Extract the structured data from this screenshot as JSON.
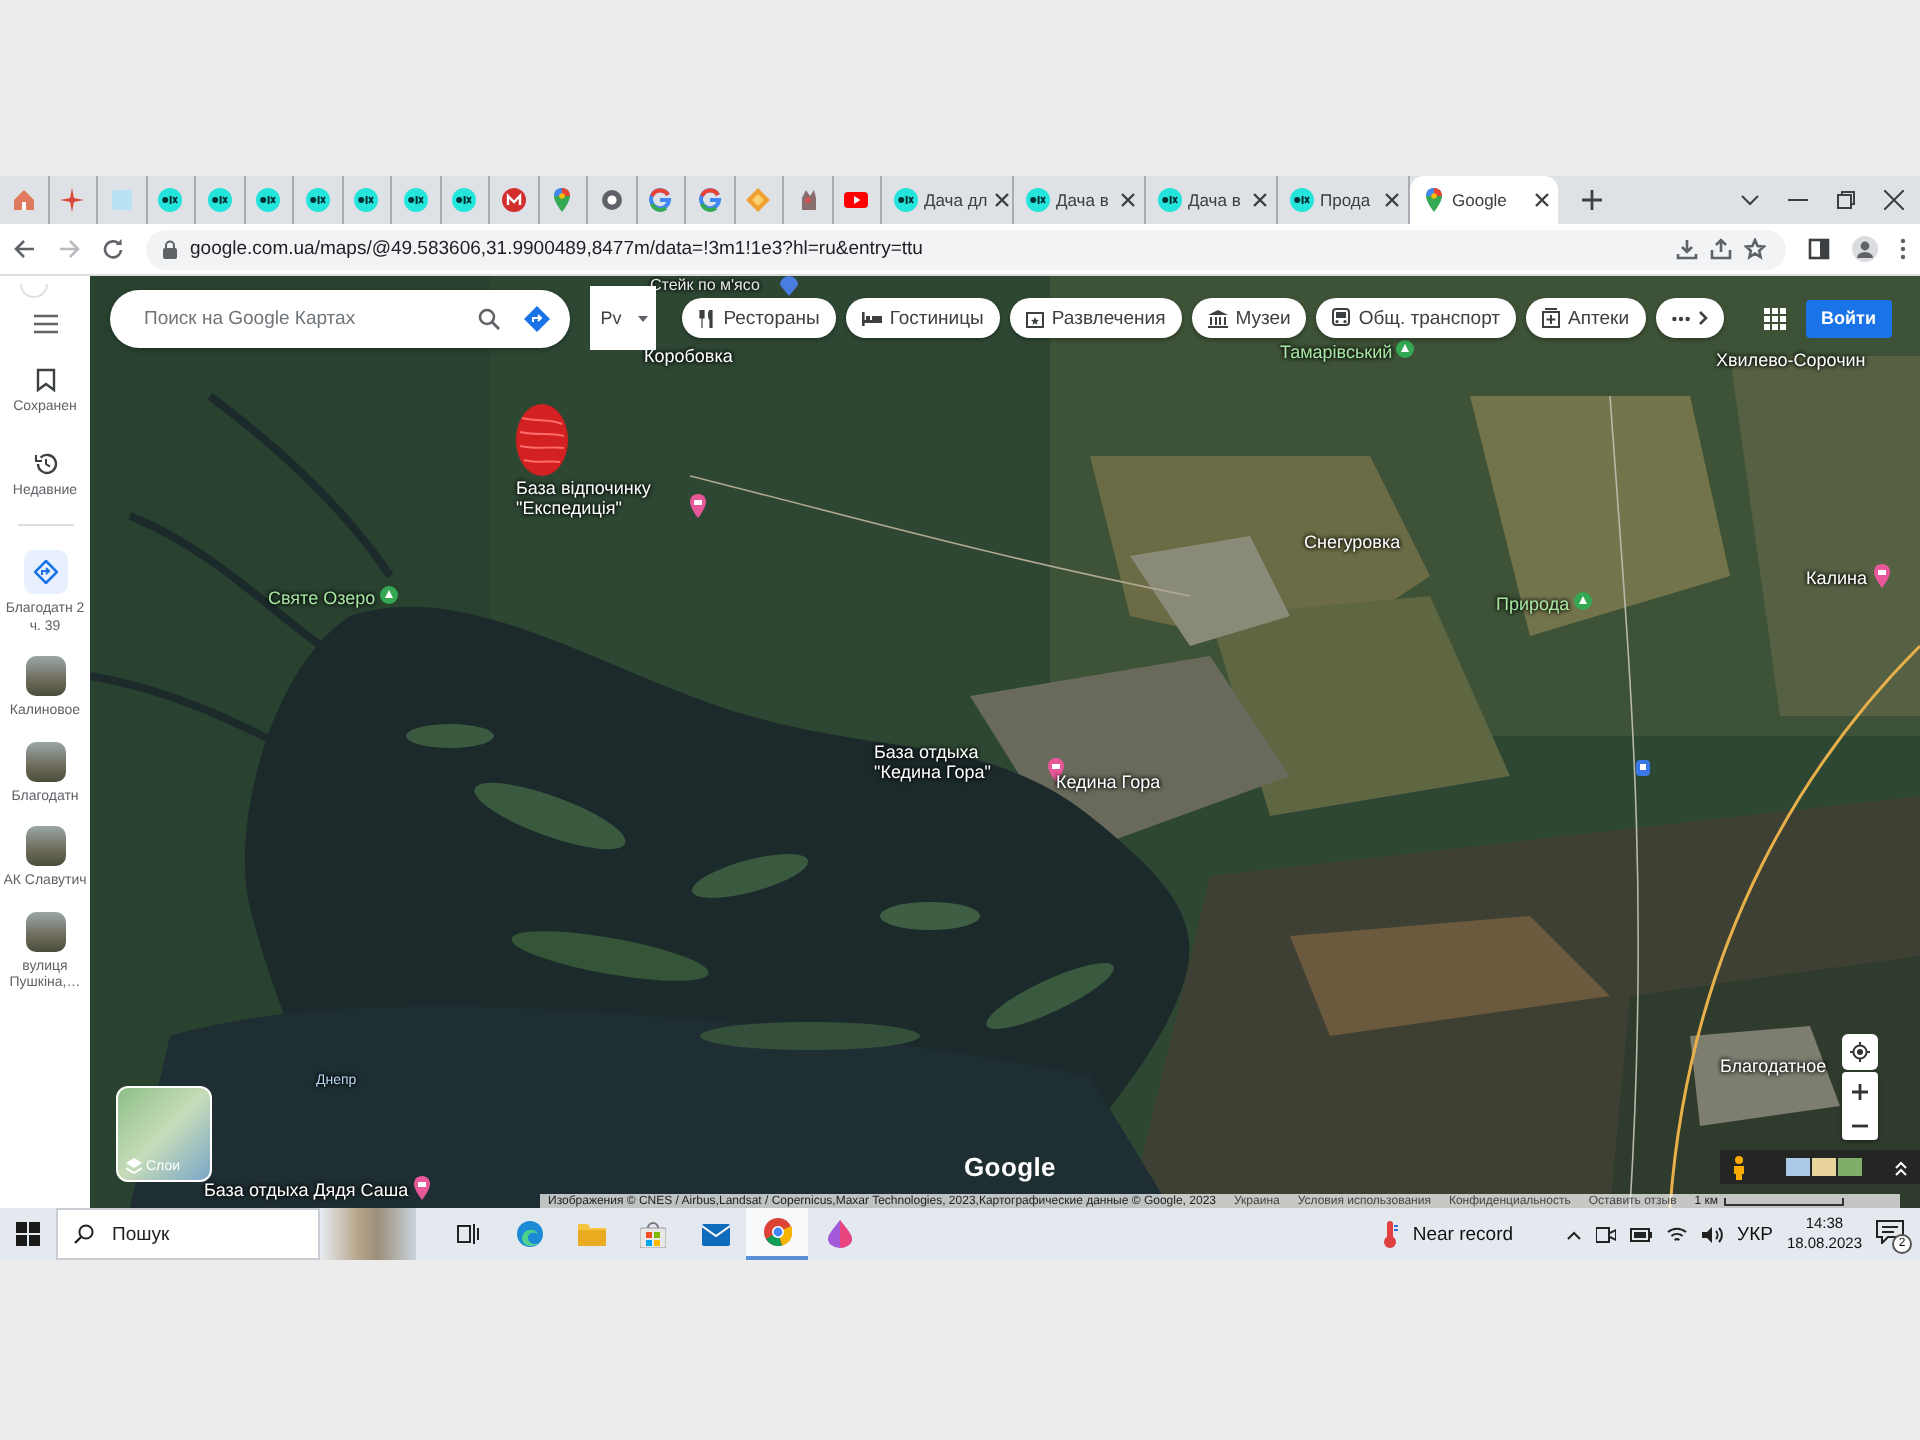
{
  "browser": {
    "tabs": [
      {
        "kind": "home",
        "selected": false
      },
      {
        "kind": "sparkle",
        "selected": false
      },
      {
        "kind": "square",
        "selected": false
      },
      {
        "kind": "olx",
        "selected": false
      },
      {
        "kind": "olx",
        "selected": false
      },
      {
        "kind": "olx",
        "selected": false
      },
      {
        "kind": "olx",
        "selected": false
      },
      {
        "kind": "olx",
        "selected": false
      },
      {
        "kind": "olx",
        "selected": false
      },
      {
        "kind": "olx",
        "selected": false
      },
      {
        "kind": "mail",
        "selected": false
      },
      {
        "kind": "pin",
        "selected": false
      },
      {
        "kind": "ring",
        "selected": false
      },
      {
        "kind": "google",
        "selected": false
      },
      {
        "kind": "google",
        "selected": false
      },
      {
        "kind": "fox",
        "selected": false
      },
      {
        "kind": "cat",
        "selected": false
      },
      {
        "kind": "youtube",
        "selected": false
      },
      {
        "kind": "olx",
        "label": "Дача дл",
        "selected": false
      },
      {
        "kind": "olx",
        "label": "Дача в",
        "selected": false
      },
      {
        "kind": "olx",
        "label": "Дача в",
        "selected": false
      },
      {
        "kind": "olx",
        "label": "Прода",
        "selected": false
      },
      {
        "kind": "pin",
        "label": "Google",
        "selected": true
      }
    ],
    "address": "google.com.ua/maps/@49.583606,31.9900489,8477m/data=!3m1!1e3?hl=ru&entry=ttu"
  },
  "sidebar": {
    "items": [
      {
        "kind": "saved",
        "label": "Сохранен"
      },
      {
        "kind": "recent",
        "label": "Недавние"
      }
    ],
    "places": [
      {
        "kind": "route",
        "label": "Благодатн 2 ч. 39"
      },
      {
        "kind": "photo",
        "label": "Калиновое"
      },
      {
        "kind": "photo",
        "label": "Благодатн"
      },
      {
        "kind": "photo",
        "label": "АК Славутич"
      },
      {
        "kind": "photo",
        "label": "вулиця Пушкіна,…"
      }
    ]
  },
  "map": {
    "search": {
      "placeholder": "Поиск на Google Картах"
    },
    "mode_field": "Pv",
    "chips": [
      {
        "kind": "restaurant",
        "label": "Рестораны"
      },
      {
        "kind": "hotel",
        "label": "Гостиницы"
      },
      {
        "kind": "ticket",
        "label": "Развлечения"
      },
      {
        "kind": "museum",
        "label": "Музеи"
      },
      {
        "kind": "transit",
        "label": "Общ. транспорт"
      },
      {
        "kind": "pharmacy",
        "label": "Аптеки"
      }
    ],
    "sign_in": "Войти",
    "labels": [
      {
        "kind": "small",
        "text": "Стейк по м'ясо"
      },
      {
        "kind": "town",
        "text": "Коробовка"
      },
      {
        "kind": "park",
        "text": "Тамарівський"
      },
      {
        "kind": "town",
        "text": "Хвилево-Сорочин"
      },
      {
        "kind": "poi",
        "text": "База відпочинку \"Експедиція\""
      },
      {
        "kind": "park",
        "text": "Святе Озеро"
      },
      {
        "kind": "town",
        "text": "Снегуровка"
      },
      {
        "kind": "park",
        "text": "Природа"
      },
      {
        "kind": "poi",
        "text": "Калина"
      },
      {
        "kind": "poi",
        "text": "База отдыха \"Кедина Гора\""
      },
      {
        "kind": "town",
        "text": "Кедина Гора"
      },
      {
        "kind": "town",
        "text": "Благодатное"
      },
      {
        "kind": "water",
        "text": "Днепр"
      },
      {
        "kind": "poi",
        "text": "База отдыха Дядя Саша"
      }
    ],
    "layers_label": "Слои",
    "logo": "Google",
    "attribution": [
      "Изображения © CNES / Airbus,Landsat / Copernicus,Maxar Technologies, 2023,Картографические данные © Google, 2023",
      "Украина",
      "Условия использования",
      "Конфиденциальность",
      "Оставить отзыв"
    ],
    "scale": "1 км"
  },
  "taskbar": {
    "search_placeholder": "Пошук",
    "apps": [
      {
        "kind": "taskview",
        "selected": false
      },
      {
        "kind": "edge",
        "selected": false
      },
      {
        "kind": "explorer",
        "selected": false
      },
      {
        "kind": "store",
        "selected": false
      },
      {
        "kind": "mail",
        "selected": false
      },
      {
        "kind": "chrome",
        "selected": true
      },
      {
        "kind": "drop",
        "selected": false
      }
    ],
    "weather": "Near record",
    "language": "УКР",
    "time": "14:38",
    "date": "18.08.2023",
    "notifications": "2"
  }
}
